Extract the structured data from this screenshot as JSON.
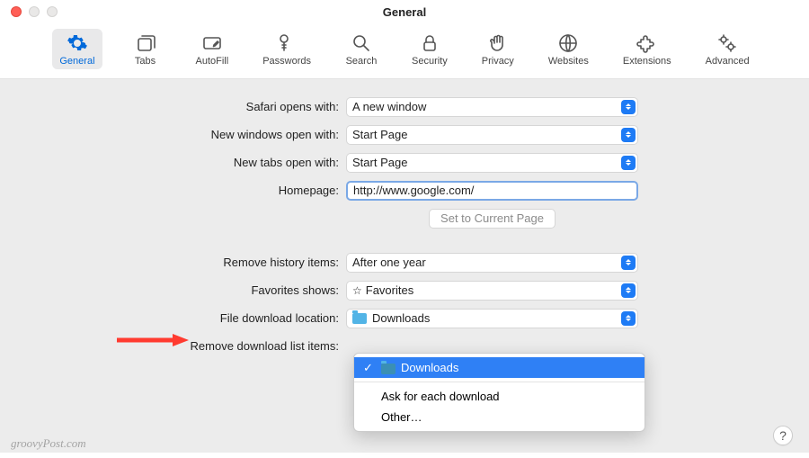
{
  "window": {
    "title": "General"
  },
  "toolbar": {
    "items": [
      {
        "id": "general",
        "label": "General"
      },
      {
        "id": "tabs",
        "label": "Tabs"
      },
      {
        "id": "autofill",
        "label": "AutoFill"
      },
      {
        "id": "passwords",
        "label": "Passwords"
      },
      {
        "id": "search",
        "label": "Search"
      },
      {
        "id": "security",
        "label": "Security"
      },
      {
        "id": "privacy",
        "label": "Privacy"
      },
      {
        "id": "websites",
        "label": "Websites"
      },
      {
        "id": "extensions",
        "label": "Extensions"
      },
      {
        "id": "advanced",
        "label": "Advanced"
      }
    ],
    "active": "general"
  },
  "form": {
    "safari_opens_with": {
      "label": "Safari opens with:",
      "value": "A new window"
    },
    "new_windows_open_with": {
      "label": "New windows open with:",
      "value": "Start Page"
    },
    "new_tabs_open_with": {
      "label": "New tabs open with:",
      "value": "Start Page"
    },
    "homepage": {
      "label": "Homepage:",
      "value": "http://www.google.com/"
    },
    "set_current_btn": "Set to Current Page",
    "remove_history": {
      "label": "Remove history items:",
      "value": "After one year"
    },
    "favorites_shows": {
      "label": "Favorites shows:",
      "value": "Favorites"
    },
    "file_download_location": {
      "label": "File download location:",
      "value": "Downloads"
    },
    "remove_download_list": {
      "label": "Remove download list items:"
    }
  },
  "dropdown": {
    "options": [
      {
        "label": "Downloads",
        "selected": true,
        "folder": true
      },
      {
        "label": "Ask for each download"
      },
      {
        "label": "Other…"
      }
    ]
  },
  "watermark": "groovyPost.com",
  "help": "?"
}
